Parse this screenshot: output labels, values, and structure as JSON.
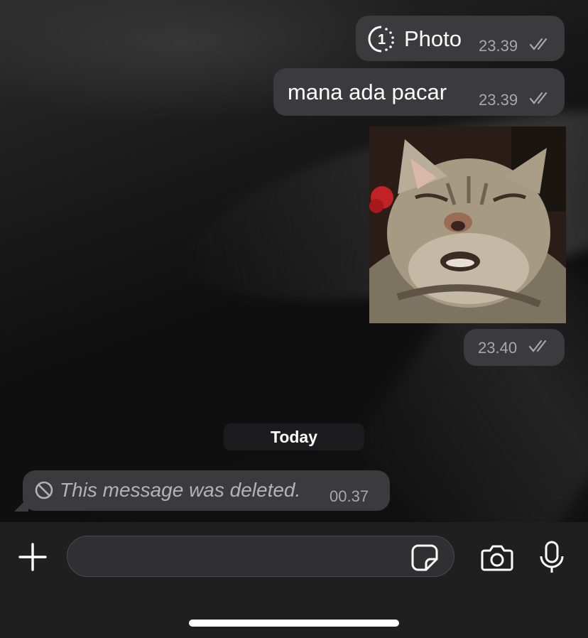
{
  "messages": {
    "view_once_photo": {
      "label": "Photo",
      "time": "23.39",
      "icon": "view-once-icon"
    },
    "text_message": {
      "text": "mana ada pacar",
      "time": "23.39"
    },
    "sticker": {
      "image": "cat-sticker",
      "time": "23.40"
    },
    "date_separator": "Today",
    "deleted_message": {
      "text": "This message was deleted.",
      "time": "00.37",
      "icon": "ban-icon"
    }
  },
  "composer": {
    "input_value": "",
    "input_placeholder": "",
    "icons": [
      "plus-icon",
      "sticker-icon",
      "camera-icon",
      "microphone-icon"
    ]
  },
  "colors": {
    "bubble": "#3b3b3d",
    "meta_text": "#a8a8ac",
    "composer_bg": "#1f1f1f"
  }
}
